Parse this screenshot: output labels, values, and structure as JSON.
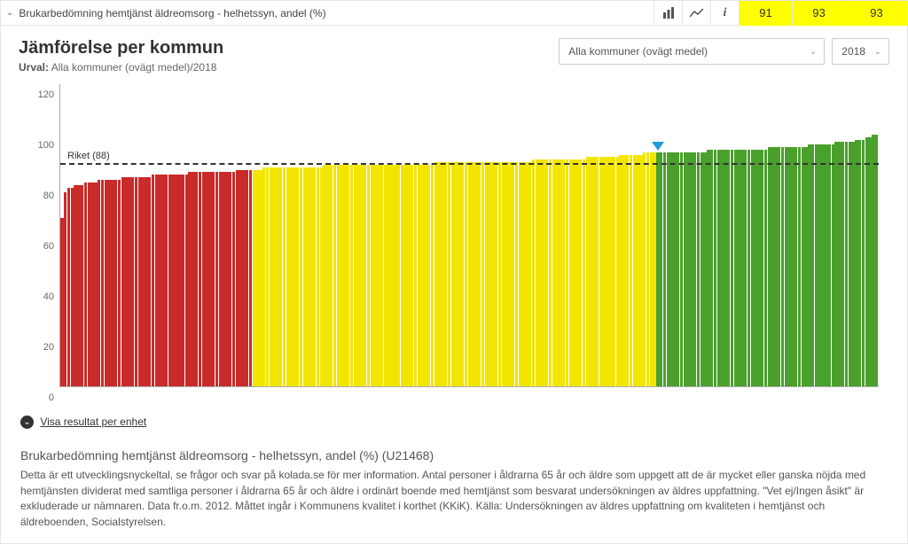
{
  "topbar": {
    "title": "Brukarbedömning hemtjänst äldreomsorg - helhetssyn, andel (%)",
    "metrics": [
      "91",
      "93",
      "93"
    ]
  },
  "header": {
    "title": "Jämförelse per kommun",
    "sub_label": "Urval:",
    "sub_value": "Alla kommuner (ovägt medel)/2018",
    "filter_label": "Alla kommuner (ovägt medel)",
    "year": "2018"
  },
  "reference": {
    "label": "Riket (88)",
    "value": 88
  },
  "link": {
    "label": "Visa resultat per enhet"
  },
  "desc": {
    "title": "Brukarbedömning hemtjänst äldreomsorg - helhetssyn, andel (%) (U21468)",
    "body": "Detta är ett utvecklingsnyckeltal, se frågor och svar på kolada.se för mer information. Antal personer i åldrarna 65 år och äldre som uppgett att de är mycket eller ganska nöjda med hemtjänsten dividerat med samtliga personer i åldrarna 65 år och äldre i ordinärt boende med hemtjänst som besvarat undersökningen av äldres uppfattning. \"Vet ej/Ingen åsikt\" är exkluderade ur nämnaren. Data fr.o.m. 2012. Måttet ingår i Kommunens kvalitet i korthet (KKiK). Källa: Undersökningen av äldres uppfattning om kvaliteten i hemtjänst och äldreboenden, Socialstyrelsen."
  },
  "chart_data": {
    "type": "bar",
    "xlabel": "",
    "ylabel": "",
    "ylim": [
      0,
      120
    ],
    "yticks": [
      0,
      20,
      40,
      60,
      80,
      100,
      120
    ],
    "reference_line": 88,
    "marker_index": 177,
    "series": [
      {
        "name": "red",
        "color": "#c92a2a",
        "values": [
          67,
          77,
          79,
          79,
          80,
          80,
          80,
          81,
          81,
          81,
          81,
          82,
          82,
          82,
          82,
          82,
          82,
          82,
          83,
          83,
          83,
          83,
          83,
          83,
          83,
          83,
          83,
          84,
          84,
          84,
          84,
          84,
          84,
          84,
          84,
          84,
          84,
          84,
          85,
          85,
          85,
          85,
          85,
          85,
          85,
          85,
          85,
          85,
          85,
          85,
          85,
          85,
          86,
          86,
          86,
          86,
          86
        ]
      },
      {
        "name": "yellow",
        "color": "#f2e600",
        "values": [
          86,
          86,
          86,
          87,
          87,
          87,
          87,
          87,
          87,
          87,
          87,
          87,
          87,
          87,
          87,
          87,
          87,
          87,
          87,
          87,
          87,
          88,
          88,
          88,
          88,
          88,
          88,
          88,
          88,
          88,
          88,
          88,
          88,
          88,
          88,
          88,
          88,
          88,
          88,
          88,
          88,
          88,
          88,
          88,
          88,
          88,
          88,
          88,
          88,
          88,
          88,
          88,
          88,
          88,
          89,
          89,
          89,
          89,
          89,
          89,
          89,
          89,
          89,
          89,
          89,
          89,
          89,
          89,
          89,
          89,
          89,
          89,
          89,
          89,
          89,
          89,
          89,
          89,
          89,
          89,
          89,
          89,
          89,
          90,
          90,
          90,
          90,
          90,
          90,
          90,
          90,
          90,
          90,
          90,
          90,
          90,
          90,
          90,
          90,
          91,
          91,
          91,
          91,
          91,
          91,
          91,
          91,
          91,
          91,
          92,
          92,
          92,
          92,
          92,
          92,
          92,
          93,
          93,
          93,
          93
        ]
      },
      {
        "name": "green",
        "color": "#4aa02c",
        "values": [
          93,
          93,
          93,
          93,
          93,
          93,
          93,
          93,
          93,
          93,
          93,
          93,
          93,
          93,
          93,
          94,
          94,
          94,
          94,
          94,
          94,
          94,
          94,
          94,
          94,
          94,
          94,
          94,
          94,
          94,
          94,
          94,
          94,
          95,
          95,
          95,
          95,
          95,
          95,
          95,
          95,
          95,
          95,
          95,
          95,
          96,
          96,
          96,
          96,
          96,
          96,
          96,
          96,
          97,
          97,
          97,
          97,
          97,
          97,
          98,
          98,
          98,
          99,
          99,
          100,
          100
        ]
      }
    ]
  }
}
